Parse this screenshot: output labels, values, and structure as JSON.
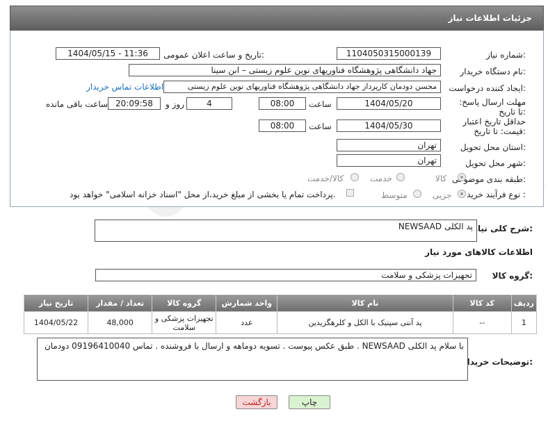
{
  "header": {
    "title": "جزئیات اطلاعات نیاز"
  },
  "form": {
    "need_number_label": "شماره نیاز:",
    "need_number": "1104050315000139",
    "announce_label": "تاریخ و ساعت اعلان عمومی:",
    "announce_value": "1404/05/15 - 11:36",
    "buyer_org_label": "نام دستگاه خریدار:",
    "buyer_org": "جهاد دانشگاهی پژوهشگاه فناوریهای نوین علوم زیستی – ابن سینا",
    "creator_label": "ایجاد کننده درخواست:",
    "creator": "محسن دودمان کارپرداز جهاد دانشگاهی پژوهشگاه فناوریهای نوین علوم زیستی",
    "contact_link": "اطلاعات تماس خریدار",
    "reply_deadline_label": "مهلت ارسال پاسخ: تا تاریخ:",
    "reply_date": "1404/05/20",
    "time_label": "ساعت",
    "reply_time": "08:00",
    "days_value": "4",
    "days_label": "روز و",
    "remaining_time": "20:09:58",
    "remaining_label": "ساعت باقی مانده",
    "price_deadline_label": "حداقل تاریخ اعتبار قیمت: تا تاریخ:",
    "price_date": "1404/05/30",
    "price_time": "08:00",
    "province_label": "استان محل تحویل:",
    "province": "تهران",
    "city_label": "شهر محل تحویل:",
    "city": "تهران",
    "category_label": "طبقه بندی موضوعی:",
    "category_options": [
      "کالا",
      "خدمت",
      "کالا/خدمت"
    ],
    "process_label": "نوع فرآیند خرید :",
    "process_options": [
      "جزیی",
      "متوسط"
    ],
    "payment_note": "پرداخت تمام یا بخشی از مبلغ خرید،از محل \"اسناد خزانه اسلامی\" خواهد بود."
  },
  "description": {
    "label": "شرح کلی نیاز:",
    "value": "پد الکلی  NEWSAAD"
  },
  "goods_info_title": "اطلاعات کالاهای مورد نیاز",
  "goods_group": {
    "label": "گروه کالا:",
    "value": "تجهیزات پزشکی و سلامت"
  },
  "table": {
    "headers": [
      "ردیف",
      "کد کالا",
      "نام کالا",
      "واحد شمارش",
      "گروه کالا",
      "تعداد / مقدار",
      "تاریخ نیاز"
    ],
    "rows": [
      [
        "1",
        "--",
        "پد آنتی سپتیک با الکل و کلرهگزیدین",
        "عدد",
        "تجهیزات پزشکی و سلامت",
        "48,000",
        "1404/05/22"
      ]
    ]
  },
  "buyer_notes": {
    "label": "توضیحات خریدار:",
    "value": "با سلام پد الکلی  NEWSAAD . طبق عکس پیوست . تسویه دوماهه و ارسال با فروشنده . تماس 09196410040 دودمان"
  },
  "buttons": {
    "print": "چاپ",
    "back": "بازگشت"
  },
  "watermark": "AriaTender.neT",
  "colors": {
    "header_bg": "#6f6f6f",
    "link": "#1a6fbf",
    "back_bg": "#f6d6d6",
    "print_bg": "#d9f2d0"
  }
}
